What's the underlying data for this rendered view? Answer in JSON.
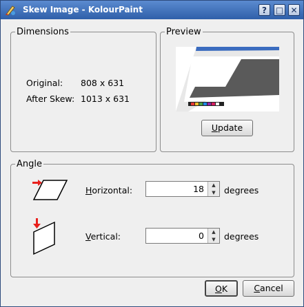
{
  "window": {
    "title": "Skew Image - KolourPaint",
    "controls": {
      "help": "?",
      "maximize": "□",
      "close": "✕"
    }
  },
  "dimensions": {
    "legend": "Dimensions",
    "original_label": "Original:",
    "original_value": "808 x 631",
    "after_label": "After Skew:",
    "after_value": "1013 x 631"
  },
  "preview": {
    "legend": "Preview",
    "update_button_u": "U",
    "update_button_rest": "pdate"
  },
  "angle": {
    "legend": "Angle",
    "horizontal_label_u": "H",
    "horizontal_label_rest": "orizontal:",
    "horizontal_value": "18",
    "vertical_label_u": "V",
    "vertical_label_rest": "ertical:",
    "vertical_value": "0",
    "unit": "degrees"
  },
  "buttons": {
    "ok_u": "O",
    "ok_rest": "K",
    "cancel_u": "C",
    "cancel_rest": "ancel"
  },
  "colors": {
    "accent": "#2f5fa9",
    "arrow": "#e8201c"
  },
  "icons": [
    "kolourpaint-app-icon",
    "help-icon",
    "maximize-icon",
    "close-icon",
    "horizontal-skew-icon",
    "vertical-skew-icon",
    "spin-up-icon",
    "spin-down-icon"
  ]
}
